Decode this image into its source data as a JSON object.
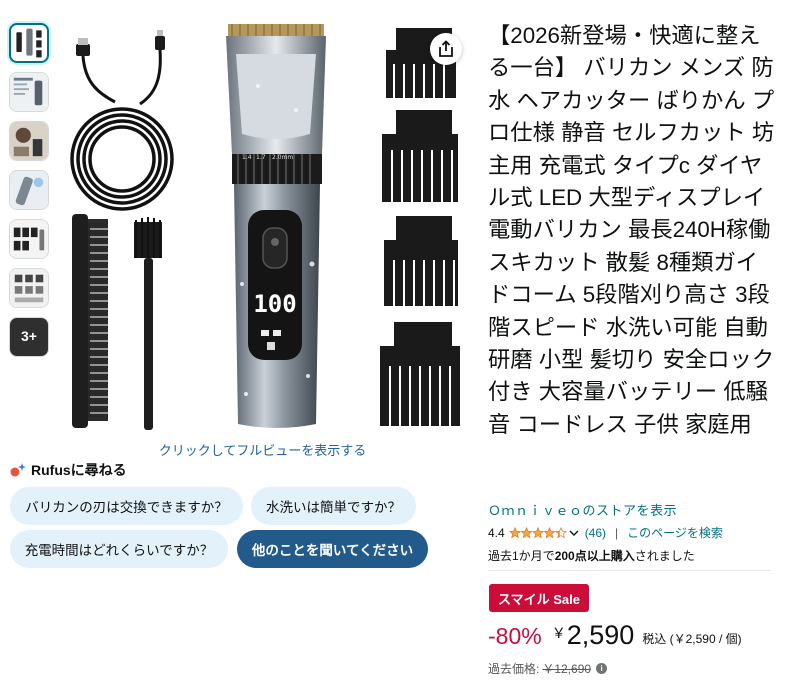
{
  "thumbnails": [
    {
      "icon": "clipper-set-thumb"
    },
    {
      "icon": "spec-sheet-thumb"
    },
    {
      "icon": "usage-photo-thumb"
    },
    {
      "icon": "feature-thumb"
    },
    {
      "icon": "guide-comb-thumb"
    },
    {
      "icon": "package-contents-thumb"
    },
    {
      "icon": "more-thumb",
      "label": "3+"
    }
  ],
  "product_image": {
    "display_readout": "100",
    "dial_marks": [
      "1.4",
      "1.7",
      "2.0mm"
    ]
  },
  "fullview_link": "クリックしてフルビューを表示する",
  "rufus": {
    "heading": "Rufusに尋ねる",
    "chips": [
      "バリカンの刃は交換できますか？",
      "水洗いは簡単ですか？",
      "充電時間はどれくらいですか？",
      "他のことを聞いてください"
    ]
  },
  "title": "【2026新登場・快適に整える一台】 バリカン メンズ 防水 ヘアカッター ばりかん プロ仕様 静音 セルフカット 坊主用 充電式 タイプc ダイヤル式 LED 大型ディスプレイ 電動バリカン 最長240H稼働 スキカット 散髪 8種類ガイドコーム 5段階刈り高さ 3段階スピード 水洗い可能 自動研磨 小型 髪切り 安全ロック付き 大容量バッテリー 低騒音 コードレス 子供 家庭用",
  "store_link": "Ｏｍｎｉｖｅｏのストアを表示",
  "rating": {
    "value": "4.4",
    "stars": 4.4,
    "reviews": "(46)",
    "separator": "|",
    "search_link": "このページを検索"
  },
  "bought": {
    "prefix": "過去1か月で",
    "count": "200点以上購入",
    "suffix": "されました"
  },
  "sale_badge": "スマイル Sale",
  "price": {
    "discount": "-80%",
    "currency": "￥",
    "amount": "2,590",
    "tax_note": "税込 (￥2,590 / 個)"
  },
  "past_price": {
    "label": "過去価格:",
    "value": "￥12,690",
    "info_icon": "i"
  },
  "colors": {
    "link": "#007185",
    "sale_red": "#cc0c39",
    "chip_bg": "#e3f1fb",
    "chip_primary": "#235a8c",
    "star": "#f3a847"
  }
}
